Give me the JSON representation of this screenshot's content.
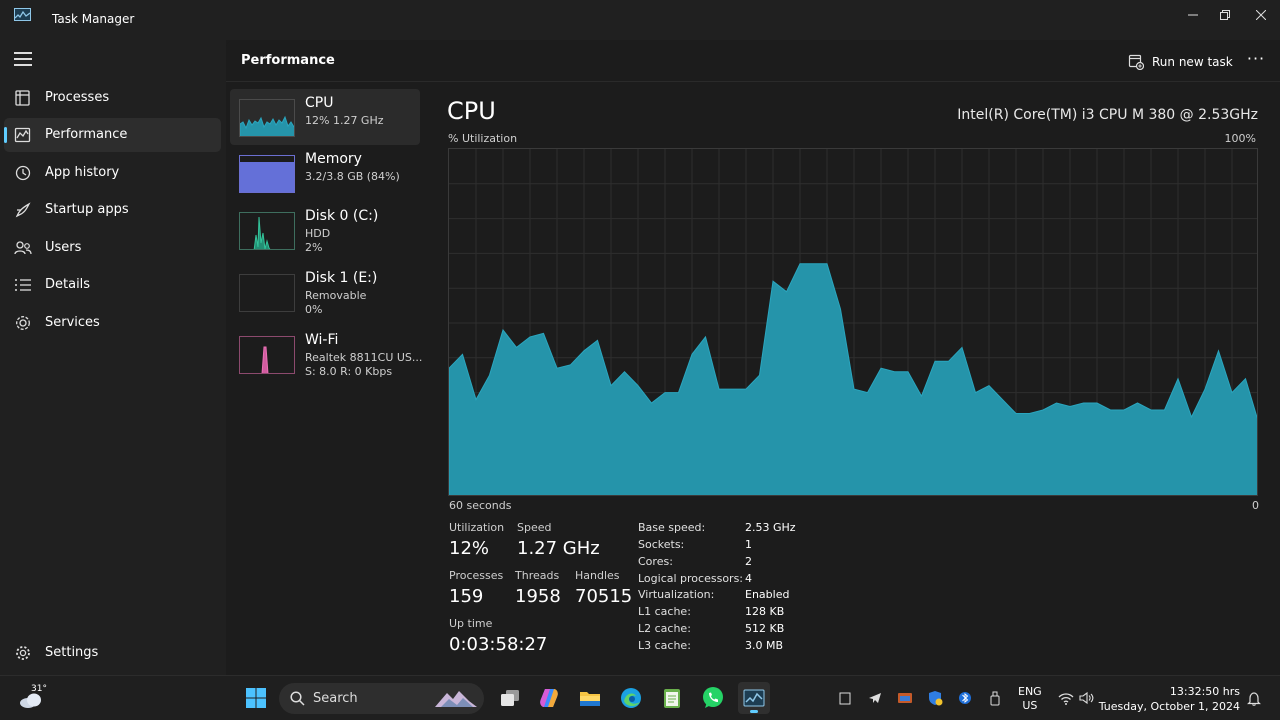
{
  "window": {
    "title": "Task Manager"
  },
  "sidebar": {
    "items": [
      {
        "label": "Processes",
        "icon": "processes-icon"
      },
      {
        "label": "Performance",
        "icon": "performance-icon",
        "active": true
      },
      {
        "label": "App history",
        "icon": "app-history-icon"
      },
      {
        "label": "Startup apps",
        "icon": "startup-apps-icon"
      },
      {
        "label": "Users",
        "icon": "users-icon"
      },
      {
        "label": "Details",
        "icon": "details-icon"
      },
      {
        "label": "Services",
        "icon": "services-icon"
      }
    ],
    "settings_label": "Settings"
  },
  "header": {
    "title": "Performance",
    "run_task_label": "Run new task",
    "more_label": "···"
  },
  "resources": [
    {
      "name": "CPU",
      "line1": "12%  1.27 GHz",
      "line2": ""
    },
    {
      "name": "Memory",
      "line1": "3.2/3.8 GB (84%)",
      "line2": ""
    },
    {
      "name": "Disk 0 (C:)",
      "line1": "HDD",
      "line2": "2%"
    },
    {
      "name": "Disk 1 (E:)",
      "line1": "Removable",
      "line2": "0%"
    },
    {
      "name": "Wi-Fi",
      "line1": "Realtek 8811CU US...",
      "line2": "S: 8.0  R: 0 Kbps"
    }
  ],
  "cpu": {
    "title": "CPU",
    "model": "Intel(R) Core(TM) i3 CPU M 380 @ 2.53GHz",
    "util_label": "% Utilization",
    "util_max": "100%",
    "time_start": "60 seconds",
    "time_end": "0",
    "stats": {
      "utilization_label": "Utilization",
      "utilization": "12%",
      "speed_label": "Speed",
      "speed": "1.27 GHz",
      "processes_label": "Processes",
      "processes": "159",
      "threads_label": "Threads",
      "threads": "1958",
      "handles_label": "Handles",
      "handles": "70515",
      "uptime_label": "Up time",
      "uptime": "0:03:58:27"
    },
    "specs": [
      {
        "label": "Base speed:",
        "value": "2.53 GHz"
      },
      {
        "label": "Sockets:",
        "value": "1"
      },
      {
        "label": "Cores:",
        "value": "2"
      },
      {
        "label": "Logical processors:",
        "value": "4"
      },
      {
        "label": "Virtualization:",
        "value": "Enabled"
      },
      {
        "label": "L1 cache:",
        "value": "128 KB"
      },
      {
        "label": "L2 cache:",
        "value": "512 KB"
      },
      {
        "label": "L3 cache:",
        "value": "3.0 MB"
      }
    ],
    "history": [
      37,
      41,
      28,
      35,
      48,
      43,
      46,
      47,
      37,
      38,
      42,
      45,
      32,
      36,
      32,
      27,
      30,
      30,
      41,
      46,
      31,
      31,
      31,
      35,
      62,
      59,
      67,
      67,
      67,
      54,
      31,
      30,
      37,
      36,
      36,
      29,
      39,
      39,
      43,
      30,
      32,
      28,
      24,
      24,
      25,
      27,
      26,
      27,
      27,
      25,
      25,
      27,
      25,
      25,
      34,
      23,
      31,
      42,
      30,
      34,
      21
    ],
    "colors": {
      "line": "#2aa6bf",
      "fill": "#2594aa",
      "grid": "#2e2e2e"
    }
  },
  "taskbar": {
    "weather_temp": "31°",
    "search_placeholder": "Search",
    "lang_line1": "ENG",
    "lang_line2": "US",
    "time": "13:32:50 hrs",
    "date": "Tuesday, October 1, 2024"
  }
}
